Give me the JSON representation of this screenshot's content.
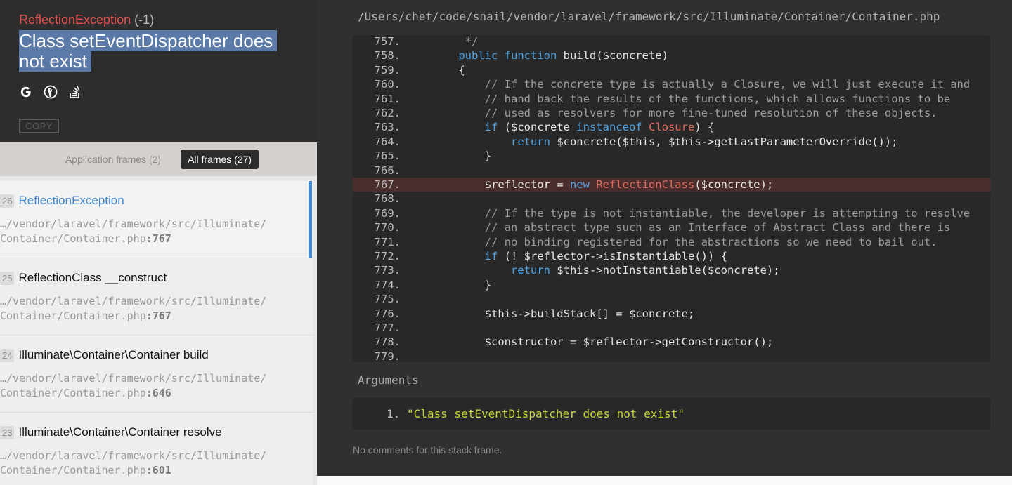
{
  "exception": {
    "type": "ReflectionException",
    "code": "(-1)",
    "message": "Class setEventDispatcher does not exist",
    "copy_label": "COPY",
    "search_icons": [
      "google-icon",
      "duckduckgo-icon",
      "stackoverflow-icon"
    ]
  },
  "frame_tabs": {
    "application": "Application frames (2)",
    "all": "All frames (27)",
    "active": "all"
  },
  "frames": [
    {
      "index": "26",
      "title": "ReflectionException",
      "path_dir": "…/vendor/laravel/framework/src/Illuminate/",
      "path_file": "Container/Container.php",
      "line": ":767",
      "active": true
    },
    {
      "index": "25",
      "title": "ReflectionClass __construct",
      "path_dir": "…/vendor/laravel/framework/src/Illuminate/",
      "path_file": "Container/Container.php",
      "line": ":767",
      "active": false
    },
    {
      "index": "24",
      "title": "Illuminate\\Container\\Container build",
      "path_dir": "…/vendor/laravel/framework/src/Illuminate/",
      "path_file": "Container/Container.php",
      "line": ":646",
      "active": false
    },
    {
      "index": "23",
      "title": "Illuminate\\Container\\Container resolve",
      "path_dir": "…/vendor/laravel/framework/src/Illuminate/",
      "path_file": "Container/Container.php",
      "line": ":601",
      "active": false
    }
  ],
  "code_view": {
    "file_path": "/Users/chet/code/snail/vendor/laravel/framework/src/Illuminate/Container/Container.php",
    "highlighted_line": "767.",
    "lines": [
      {
        "n": "757.",
        "tokens": [
          [
            "c",
            "     */"
          ]
        ]
      },
      {
        "n": "758.",
        "tokens": [
          [
            "t",
            "    "
          ],
          [
            "k",
            "public"
          ],
          [
            "t",
            " "
          ],
          [
            "k",
            "function"
          ],
          [
            "t",
            " build($concrete)"
          ]
        ]
      },
      {
        "n": "759.",
        "tokens": [
          [
            "t",
            "    {"
          ]
        ]
      },
      {
        "n": "760.",
        "tokens": [
          [
            "c",
            "        // If the concrete type is actually a Closure, we will just execute it and"
          ]
        ]
      },
      {
        "n": "761.",
        "tokens": [
          [
            "c",
            "        // hand back the results of the functions, which allows functions to be"
          ]
        ]
      },
      {
        "n": "762.",
        "tokens": [
          [
            "c",
            "        // used as resolvers for more fine-tuned resolution of these objects."
          ]
        ]
      },
      {
        "n": "763.",
        "tokens": [
          [
            "t",
            "        "
          ],
          [
            "k",
            "if"
          ],
          [
            "t",
            " ($concrete "
          ],
          [
            "k",
            "instanceof"
          ],
          [
            "t",
            " "
          ],
          [
            "x",
            "Closure"
          ],
          [
            "t",
            ") {"
          ]
        ]
      },
      {
        "n": "764.",
        "tokens": [
          [
            "t",
            "            "
          ],
          [
            "k",
            "return"
          ],
          [
            "t",
            " $concrete($this, $this->getLastParameterOverride());"
          ]
        ]
      },
      {
        "n": "765.",
        "tokens": [
          [
            "t",
            "        }"
          ]
        ]
      },
      {
        "n": "766.",
        "tokens": [
          [
            "t",
            ""
          ]
        ]
      },
      {
        "n": "767.",
        "tokens": [
          [
            "t",
            "        $reflector = "
          ],
          [
            "k",
            "new"
          ],
          [
            "t",
            " "
          ],
          [
            "x",
            "ReflectionClass"
          ],
          [
            "t",
            "($concrete);"
          ]
        ]
      },
      {
        "n": "768.",
        "tokens": [
          [
            "t",
            ""
          ]
        ]
      },
      {
        "n": "769.",
        "tokens": [
          [
            "c",
            "        // If the type is not instantiable, the developer is attempting to resolve"
          ]
        ]
      },
      {
        "n": "770.",
        "tokens": [
          [
            "c",
            "        // an abstract type such as an Interface of Abstract Class and there is"
          ]
        ]
      },
      {
        "n": "771.",
        "tokens": [
          [
            "c",
            "        // no binding registered for the abstractions so we need to bail out."
          ]
        ]
      },
      {
        "n": "772.",
        "tokens": [
          [
            "t",
            "        "
          ],
          [
            "k",
            "if"
          ],
          [
            "t",
            " (! $reflector->isInstantiable()) {"
          ]
        ]
      },
      {
        "n": "773.",
        "tokens": [
          [
            "t",
            "            "
          ],
          [
            "k",
            "return"
          ],
          [
            "t",
            " $this->notInstantiable($concrete);"
          ]
        ]
      },
      {
        "n": "774.",
        "tokens": [
          [
            "t",
            "        }"
          ]
        ]
      },
      {
        "n": "775.",
        "tokens": [
          [
            "t",
            ""
          ]
        ]
      },
      {
        "n": "776.",
        "tokens": [
          [
            "t",
            "        $this->buildStack[] = $concrete;"
          ]
        ]
      },
      {
        "n": "777.",
        "tokens": [
          [
            "t",
            ""
          ]
        ]
      },
      {
        "n": "778.",
        "tokens": [
          [
            "t",
            "        $constructor = $reflector->getConstructor();"
          ]
        ]
      },
      {
        "n": "779.",
        "tokens": [
          [
            "t",
            ""
          ]
        ]
      }
    ]
  },
  "arguments": {
    "label": "Arguments",
    "items": [
      {
        "num": "1.",
        "value": "\"Class setEventDispatcher does not exist\""
      }
    ]
  },
  "comments": {
    "text": "No comments for this stack frame."
  },
  "colors": {
    "exception_type": "#e95353",
    "active_frame": "#4288ce",
    "keyword": "#4fa3e3",
    "class_name": "#e06c60",
    "comment": "#9c9c9c",
    "argument_string": "#c8d53b",
    "highlight_bg": "#4a2d2d"
  }
}
